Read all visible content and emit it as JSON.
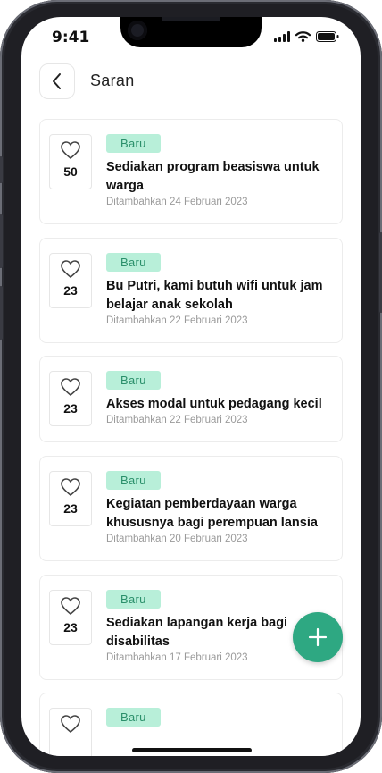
{
  "status": {
    "time": "9:41",
    "signal_icon": "signal-icon",
    "wifi_icon": "wifi-icon",
    "battery_icon": "battery-icon"
  },
  "header": {
    "title": "Saran",
    "back_icon": "chevron-left-icon"
  },
  "colors": {
    "accent": "#2ea882",
    "badge_bg": "#b8efd9",
    "badge_text": "#2a8f6a"
  },
  "suggestions": [
    {
      "likes": "50",
      "badge": "Baru",
      "title": "Sediakan program beasiswa untuk warga",
      "date": "Ditambahkan 24 Februari 2023"
    },
    {
      "likes": "23",
      "badge": "Baru",
      "title": "Bu Putri, kami butuh wifi untuk jam belajar anak sekolah",
      "date": "Ditambahkan 22 Februari 2023"
    },
    {
      "likes": "23",
      "badge": "Baru",
      "title": "Akses modal untuk pedagang kecil",
      "date": "Ditambahkan 22 Februari 2023"
    },
    {
      "likes": "23",
      "badge": "Baru",
      "title": "Kegiatan pemberdayaan warga khususnya bagi perempuan lansia",
      "date": "Ditambahkan 20 Februari 2023"
    },
    {
      "likes": "23",
      "badge": "Baru",
      "title": "Sediakan lapangan kerja bagi disabilitas",
      "date": "Ditambahkan 17 Februari 2023"
    },
    {
      "likes": "",
      "badge": "Baru",
      "title": "",
      "date": ""
    }
  ],
  "fab": {
    "icon": "plus-icon"
  }
}
